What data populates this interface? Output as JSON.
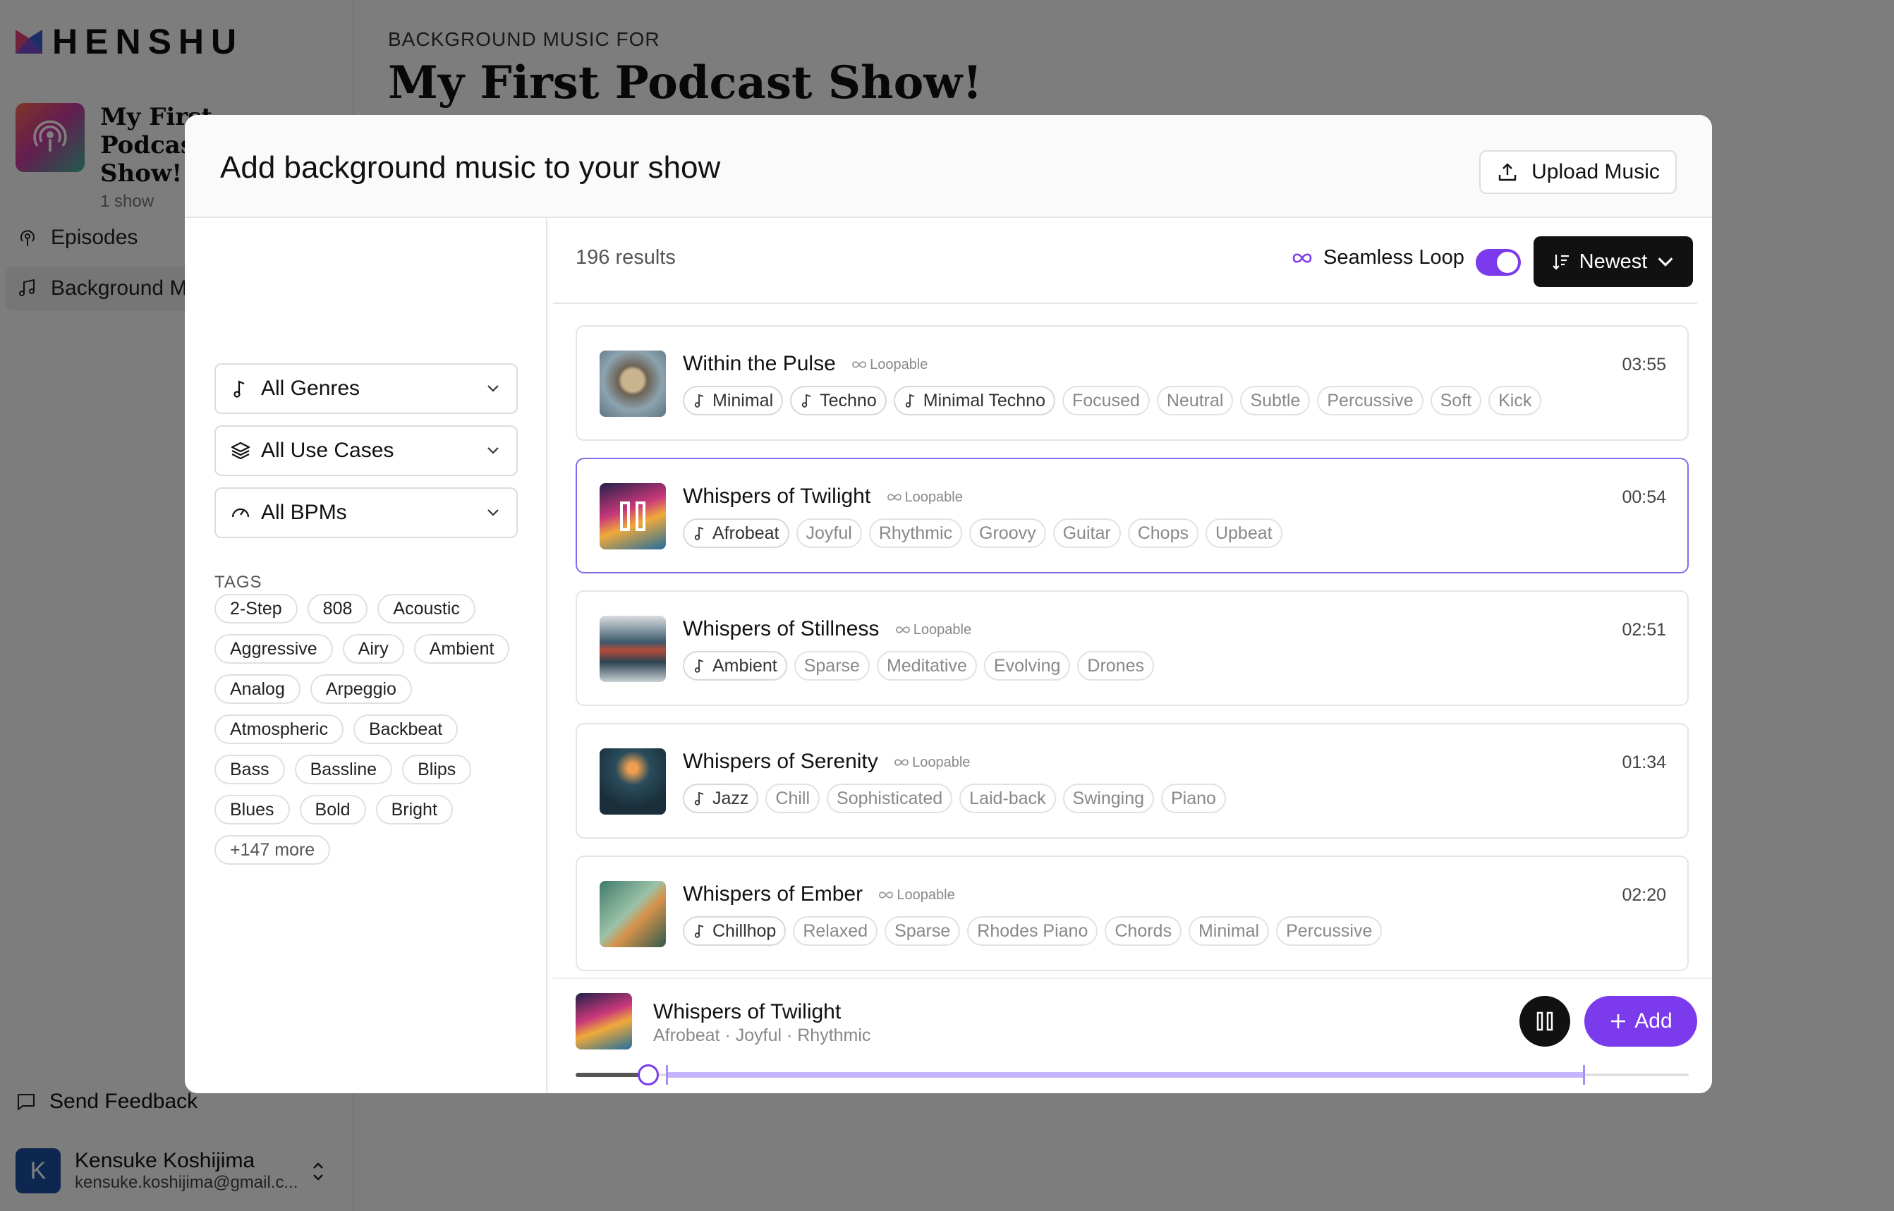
{
  "app": {
    "logo_text": "HENSHU",
    "show": {
      "title": "My First Podcast Show!",
      "subtitle": "1 show"
    },
    "nav": [
      {
        "label": "Episodes",
        "icon": "podcast-icon"
      },
      {
        "label": "Background Music",
        "icon": "music-note-icon"
      }
    ],
    "feedback_label": "Send Feedback",
    "user": {
      "initial": "K",
      "name": "Kensuke Koshijima",
      "email": "kensuke.koshijima@gmail.c..."
    },
    "main": {
      "eyebrow": "BACKGROUND MUSIC FOR",
      "title": "My First Podcast Show!"
    }
  },
  "modal": {
    "title": "Add background music to your show",
    "upload_label": "Upload Music",
    "filters": {
      "genres": "All Genres",
      "use_cases": "All Use Cases",
      "bpms": "All BPMs",
      "tags_label": "TAGS",
      "tags": [
        "2-Step",
        "808",
        "Acoustic",
        "Aggressive",
        "Airy",
        "Ambient",
        "Analog",
        "Arpeggio",
        "Atmospheric",
        "Backbeat",
        "Bass",
        "Bassline",
        "Blips",
        "Blues",
        "Bold",
        "Bright"
      ],
      "more_label": "+147 more"
    },
    "results": {
      "count": "196 results",
      "loop_label": "Seamless Loop",
      "loop_enabled": true,
      "sort_label": "Newest"
    },
    "loopable_label": "Loopable",
    "tracks": [
      {
        "title": "Within the Pulse",
        "duration": "03:55",
        "genres": [
          "Minimal",
          "Techno",
          "Minimal Techno"
        ],
        "tags": [
          "Focused",
          "Neutral",
          "Subtle",
          "Percussive",
          "Soft",
          "Kick"
        ]
      },
      {
        "title": "Whispers of Twilight",
        "duration": "00:54",
        "genres": [
          "Afrobeat"
        ],
        "tags": [
          "Joyful",
          "Rhythmic",
          "Groovy",
          "Guitar",
          "Chops",
          "Upbeat"
        ],
        "selected": true
      },
      {
        "title": "Whispers of Stillness",
        "duration": "02:51",
        "genres": [
          "Ambient"
        ],
        "tags": [
          "Sparse",
          "Meditative",
          "Evolving",
          "Drones"
        ]
      },
      {
        "title": "Whispers of Serenity",
        "duration": "01:34",
        "genres": [
          "Jazz"
        ],
        "tags": [
          "Chill",
          "Sophisticated",
          "Laid-back",
          "Swinging",
          "Piano"
        ]
      },
      {
        "title": "Whispers of Ember",
        "duration": "02:20",
        "genres": [
          "Chillhop"
        ],
        "tags": [
          "Relaxed",
          "Sparse",
          "Rhodes Piano",
          "Chords",
          "Minimal",
          "Percussive"
        ]
      }
    ],
    "player": {
      "title": "Whispers of Twilight",
      "subtitle": "Afrobeat · Joyful · Rhythmic",
      "add_label": "Add",
      "progress": 0.065
    }
  },
  "colors": {
    "accent": "#7c3aed",
    "overlay": "rgba(0,0,0,0.5)"
  }
}
